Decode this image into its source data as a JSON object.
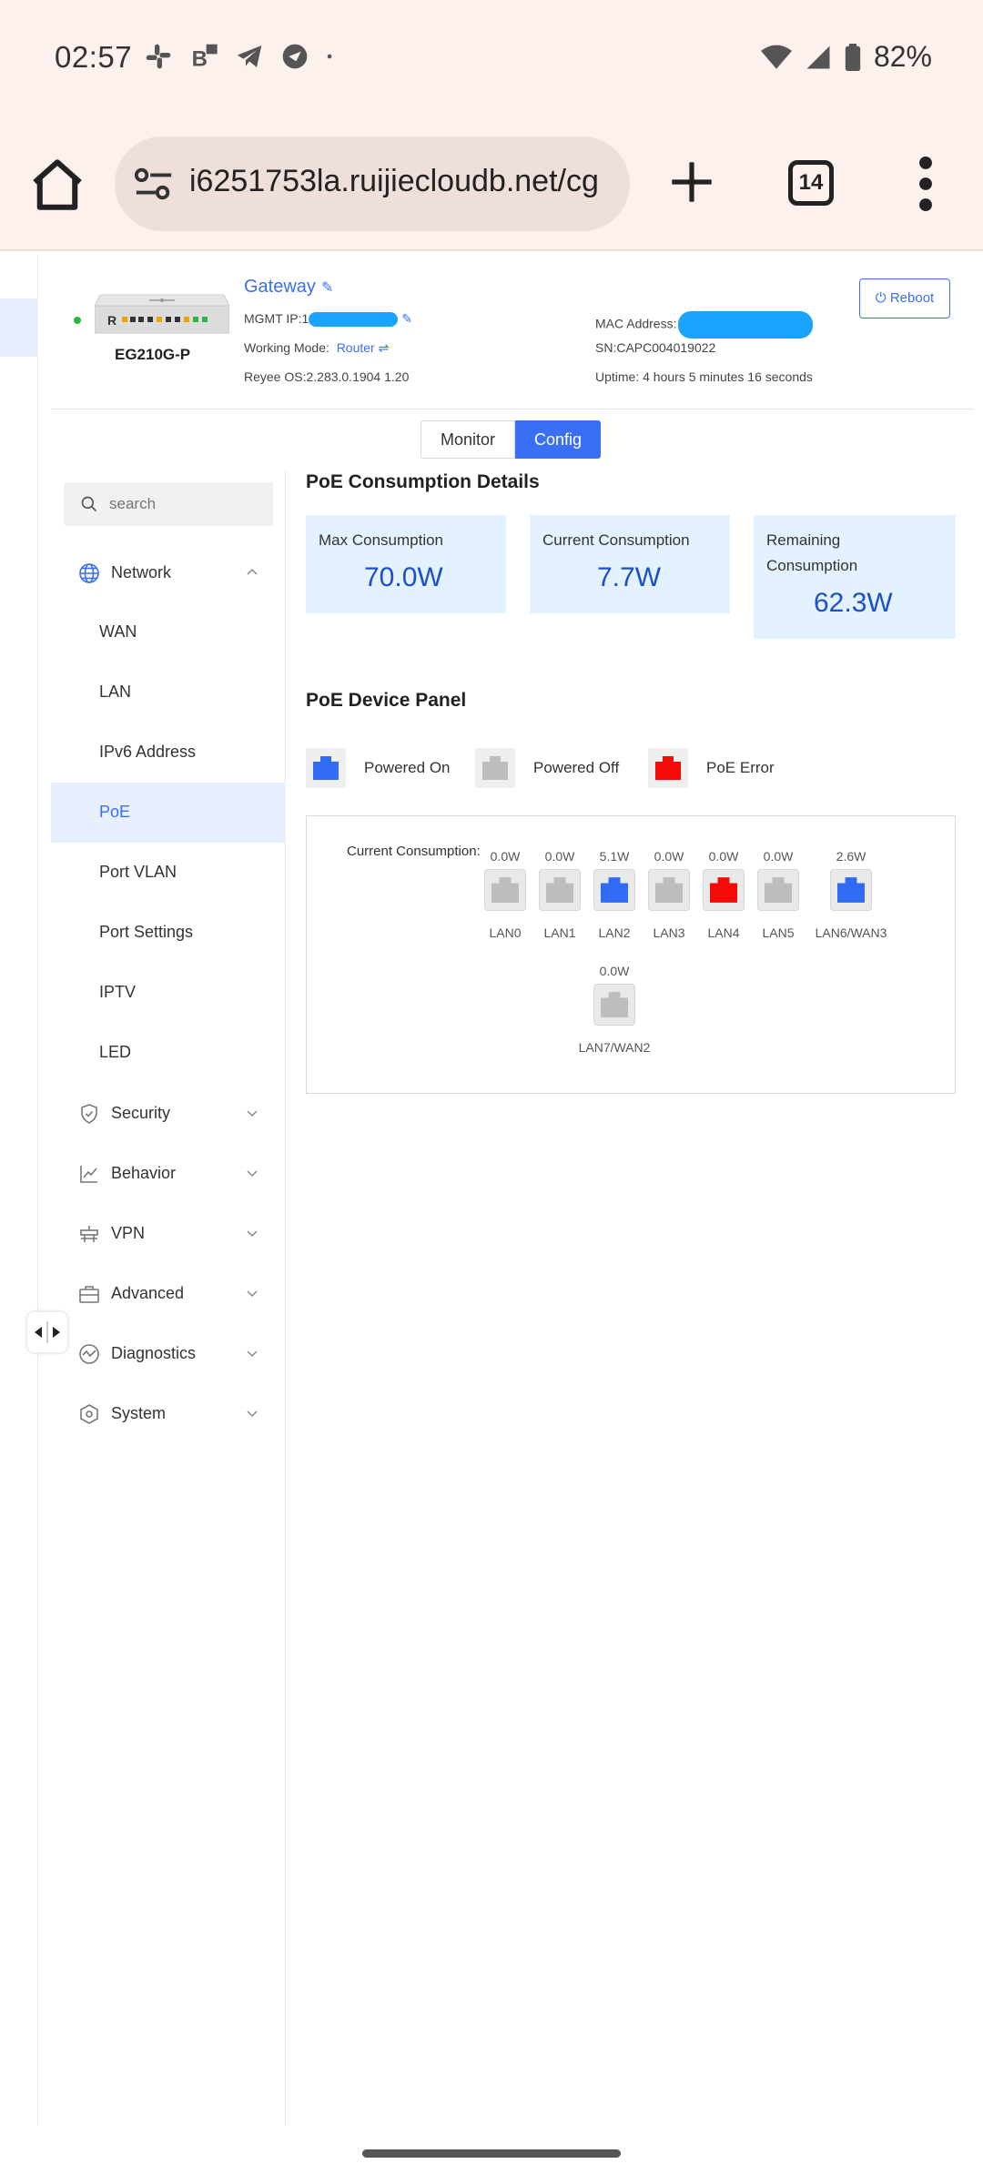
{
  "status_bar": {
    "time": "02:57",
    "battery": "82%",
    "icons": [
      "slack-icon",
      "b-notification-icon",
      "telegram-icon",
      "messenger-icon",
      "dot-icon",
      "wifi-icon",
      "signal-icon",
      "battery-icon"
    ]
  },
  "browser": {
    "url": "i6251753la.ruijiecloudb.net/cg",
    "tab_count": "14"
  },
  "device": {
    "model": "EG210G-P",
    "name": "Gateway",
    "mgmt_ip_label": "MGMT IP:",
    "mgmt_ip_value": "1",
    "working_mode_label": "Working Mode:",
    "working_mode_value": "Router",
    "os": "Reyee OS:2.283.0.1904 1.20",
    "mac_label": "MAC Address:",
    "sn": "SN:CAPC004019022",
    "uptime": "Uptime: 4 hours 5 minutes 16 seconds",
    "reboot_label": "Reboot"
  },
  "mode_tabs": {
    "monitor": "Monitor",
    "config": "Config"
  },
  "search": {
    "placeholder": "search"
  },
  "menu": {
    "network": "Network",
    "network_items": [
      "WAN",
      "LAN",
      "IPv6 Address",
      "PoE",
      "Port VLAN",
      "Port Settings",
      "IPTV",
      "LED"
    ],
    "selected": "PoE",
    "security": "Security",
    "behavior": "Behavior",
    "vpn": "VPN",
    "advanced": "Advanced",
    "diagnostics": "Diagnostics",
    "system": "System"
  },
  "poe": {
    "consumption_title": "PoE Consumption Details",
    "max_label": "Max Consumption",
    "max_value": "70.0W",
    "current_label": "Current Consumption",
    "current_value": "7.7W",
    "remaining_label": "Remaining Consumption",
    "remaining_value": "62.3W",
    "panel_title": "PoE Device Panel",
    "legend_on": "Powered On",
    "legend_off": "Powered Off",
    "legend_error": "PoE Error",
    "panel_current_label": "Current Consumption:",
    "ports": [
      {
        "name": "LAN0",
        "power": "0.0W",
        "state": "off"
      },
      {
        "name": "LAN1",
        "power": "0.0W",
        "state": "off"
      },
      {
        "name": "LAN2",
        "power": "5.1W",
        "state": "on"
      },
      {
        "name": "LAN3",
        "power": "0.0W",
        "state": "off"
      },
      {
        "name": "LAN4",
        "power": "0.0W",
        "state": "error"
      },
      {
        "name": "LAN5",
        "power": "0.0W",
        "state": "off"
      },
      {
        "name": "LAN6/WAN3",
        "power": "2.6W",
        "state": "on"
      },
      {
        "name": "LAN7/WAN2",
        "power": "0.0W",
        "state": "off"
      }
    ]
  },
  "colors": {
    "accent": "#3a6ff5",
    "on": "#2f6bf5",
    "off": "#bdbdbd",
    "error": "#f50a0a",
    "card": "#e4f1fe"
  }
}
